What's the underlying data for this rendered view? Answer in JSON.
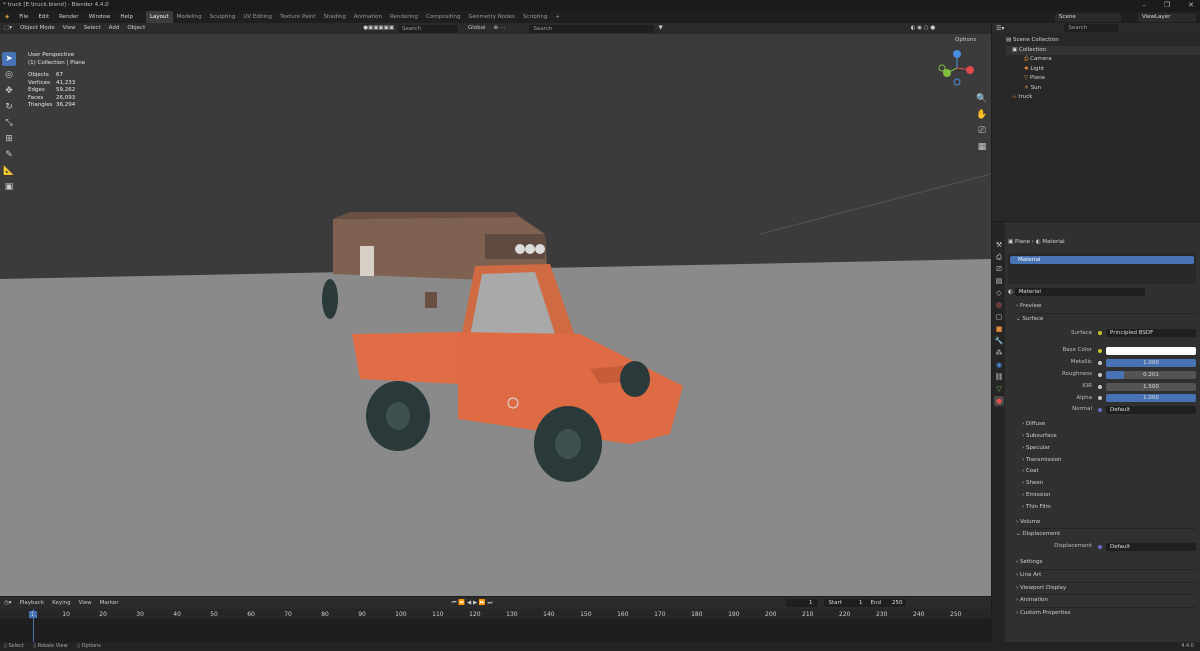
{
  "window": {
    "title": "* truck [E:\\truck.blend] - Blender 4.4.0"
  },
  "menu": [
    "File",
    "Edit",
    "Render",
    "Window",
    "Help"
  ],
  "workspaces": [
    {
      "label": "Layout",
      "active": true
    },
    {
      "label": "Modeling"
    },
    {
      "label": "Sculpting"
    },
    {
      "label": "UV Editing"
    },
    {
      "label": "Texture Paint"
    },
    {
      "label": "Shading"
    },
    {
      "label": "Animation"
    },
    {
      "label": "Rendering"
    },
    {
      "label": "Compositing"
    },
    {
      "label": "Geometry Nodes"
    },
    {
      "label": "Scripting"
    }
  ],
  "scene": {
    "name": "Scene",
    "viewlayer": "ViewLayer"
  },
  "viewport_header": {
    "mode": "Object Mode",
    "menus": [
      "View",
      "Select",
      "Add",
      "Object"
    ],
    "orientation": "Global",
    "search_placeholder": "Search",
    "options": "Options"
  },
  "overlay_info": {
    "view": "User Perspective",
    "context": "(1) Collection | Plane",
    "stats": [
      {
        "label": "Objects",
        "value": "67"
      },
      {
        "label": "Vertices",
        "value": "41,233"
      },
      {
        "label": "Edges",
        "value": "59,262"
      },
      {
        "label": "Faces",
        "value": "26,093"
      },
      {
        "label": "Triangles",
        "value": "36,294"
      }
    ]
  },
  "outliner": {
    "search_placeholder": "Search",
    "root": "Scene Collection",
    "collection": "Collection",
    "items": [
      "Camera",
      "Light",
      "Plane",
      "Sun"
    ],
    "truck": "truck"
  },
  "properties": {
    "breadcrumb": [
      "Plane",
      "Material"
    ],
    "material_slot": "Material",
    "material_name": "Material",
    "sections_top": [
      "Preview",
      "Surface"
    ],
    "surface": "Principled BSDF",
    "fields": [
      {
        "label": "Base Color",
        "type": "color"
      },
      {
        "label": "Metallic",
        "value": "1.000",
        "fill": 1.0
      },
      {
        "label": "Roughness",
        "value": "0.201",
        "fill": 0.201
      },
      {
        "label": "IOR",
        "value": "1.500",
        "fill": 0
      },
      {
        "label": "Alpha",
        "value": "1.000",
        "fill": 1.0
      },
      {
        "label": "Normal",
        "value": "Default",
        "type": "link"
      }
    ],
    "subsections": [
      "Diffuse",
      "Subsurface",
      "Specular",
      "Transmission",
      "Coat",
      "Sheen",
      "Emission",
      "Thin Film"
    ],
    "volume": "Volume",
    "displacement": "Displacement",
    "displacement_label": "Displacement",
    "displacement_value": "Default",
    "bottom": [
      "Settings",
      "Line Art",
      "Viewport Display",
      "Animation",
      "Custom Properties"
    ]
  },
  "timeline": {
    "menus": [
      "Playback",
      "Keying",
      "View",
      "Marker"
    ],
    "current_frame": "1",
    "start_label": "Start",
    "start": "1",
    "end_label": "End",
    "end": "250",
    "ticks": [
      "1",
      "10",
      "20",
      "30",
      "40",
      "50",
      "60",
      "70",
      "80",
      "90",
      "100",
      "110",
      "120",
      "130",
      "140",
      "150",
      "160",
      "170",
      "180",
      "190",
      "200",
      "210",
      "220",
      "230",
      "240",
      "250"
    ]
  },
  "statusbar": {
    "left": [
      "Select",
      "Rotate View",
      "Options"
    ],
    "version": "4.4.0"
  }
}
